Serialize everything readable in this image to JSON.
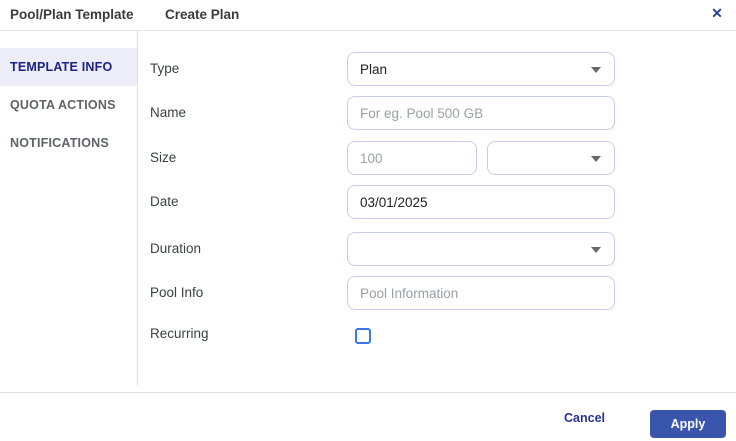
{
  "header": {
    "title": "Pool/Plan Template",
    "subtitle": "Create Plan",
    "close_icon": "✕"
  },
  "sidebar": {
    "items": [
      {
        "label": "TEMPLATE INFO",
        "selected": true
      },
      {
        "label": "QUOTA ACTIONS",
        "selected": false
      },
      {
        "label": "NOTIFICATIONS",
        "selected": false
      }
    ]
  },
  "form": {
    "type": {
      "label": "Type",
      "value": "Plan"
    },
    "name": {
      "label": "Name",
      "value": "",
      "placeholder": "For eg. Pool 500 GB"
    },
    "size": {
      "label": "Size",
      "value": "",
      "placeholder": "100",
      "unit_value": ""
    },
    "date": {
      "label": "Date",
      "value": "03/01/2025"
    },
    "duration": {
      "label": "Duration",
      "value": ""
    },
    "pool_info": {
      "label": "Pool Info",
      "value": "",
      "placeholder": "Pool Information"
    },
    "recurring": {
      "label": "Recurring",
      "checked": false
    }
  },
  "footer": {
    "cancel_label": "Cancel",
    "apply_label": "Apply"
  },
  "colors": {
    "accent": "#3a55ae",
    "navy_text": "#27338c",
    "sidebar_selected_text": "#1b2385",
    "sidebar_selected_bg": "#ecedf7",
    "field_border": "#c5cee8",
    "placeholder": "#9aa0a6",
    "label_text": "#3c4043",
    "checkbox_border": "#3b78e7",
    "divider": "#e0e0e0"
  }
}
